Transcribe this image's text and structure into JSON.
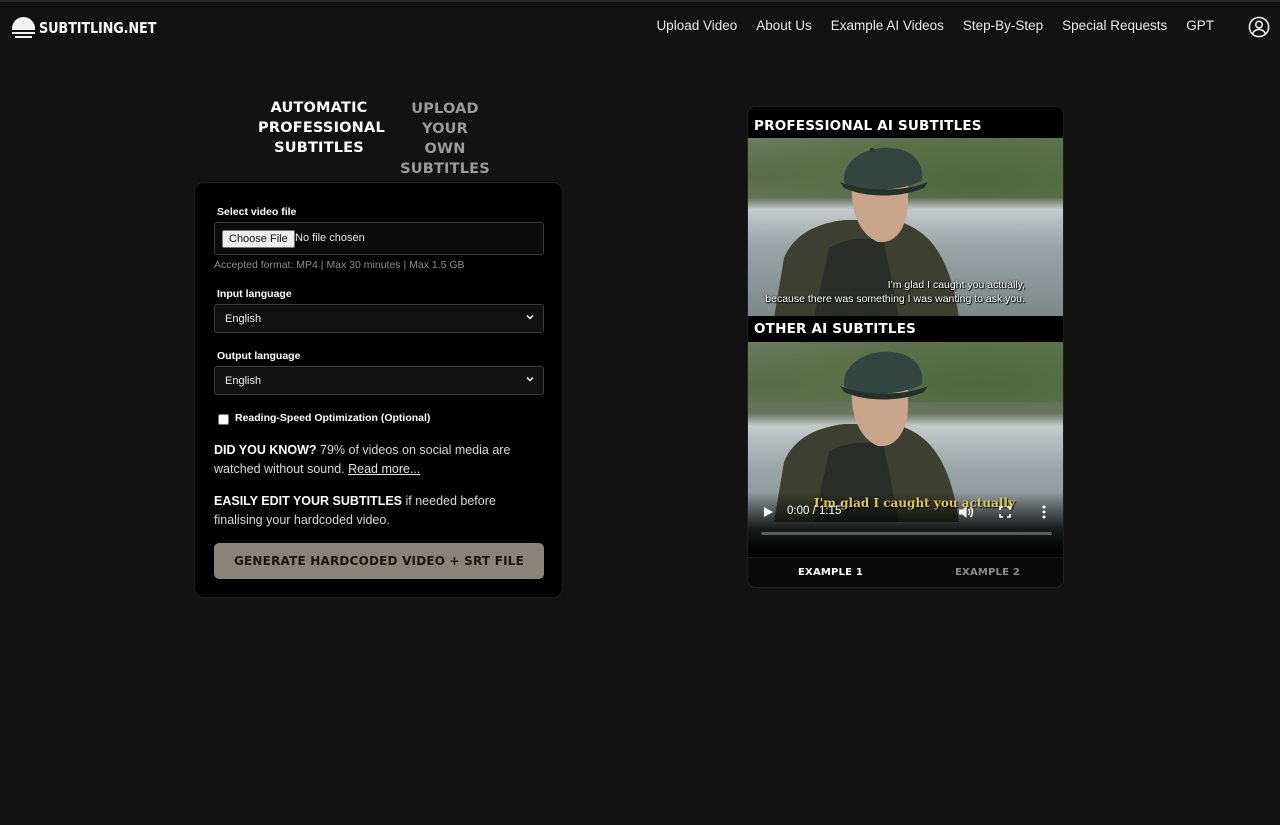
{
  "header": {
    "logo_text": "SUBTITLING.NET",
    "nav": [
      "Upload Video",
      "About Us",
      "Example AI Videos",
      "Step-By-Step",
      "Special Requests",
      "GPT"
    ],
    "user_icon": "user-circle-icon"
  },
  "tabs": {
    "active_label": "AUTOMATIC PROFESSIONAL SUBTITLES",
    "inactive_label": "UPLOAD YOUR OWN SUBTITLES"
  },
  "form": {
    "file_label": "Select video file",
    "choose_file_label": "Choose File",
    "no_file_text": "No file chosen",
    "accepted_hint": "Accepted format: MP4 | Max 30 minutes | Max 1.5 GB",
    "input_language_label": "Input language",
    "input_language_value": "English",
    "output_language_label": "Output language",
    "output_language_value": "English",
    "reading_speed_label": "Reading-Speed Optimization (Optional)",
    "reading_speed_checked": false,
    "did_you_know_title": "DID YOU KNOW?",
    "did_you_know_text": " 79% of videos on social media are watched without sound. ",
    "read_more": "Read more...",
    "edit_title": "EASILY EDIT YOUR SUBTITLES",
    "edit_text": " if needed before finalising your hardcoded video.",
    "generate_button": "GENERATE HARDCODED VIDEO + SRT FILE"
  },
  "preview": {
    "professional_heading": "PROFESSIONAL AI SUBTITLES",
    "professional_subtitle_line1": "I'm glad I caught you actually,",
    "professional_subtitle_line2": "because there was something I was wanting to ask you.",
    "other_heading": "OTHER AI SUBTITLES",
    "other_subtitle": "I'm glad I caught you actually",
    "player": {
      "time": "0:00 / 1:15",
      "progress": 0.0
    },
    "example_tabs": [
      "EXAMPLE 1",
      "EXAMPLE 2"
    ],
    "active_example": 0
  },
  "colors": {
    "background": "#121212",
    "card": "#000000",
    "button": "#8a8378",
    "subtitle_yellow": "#d9c95a"
  }
}
